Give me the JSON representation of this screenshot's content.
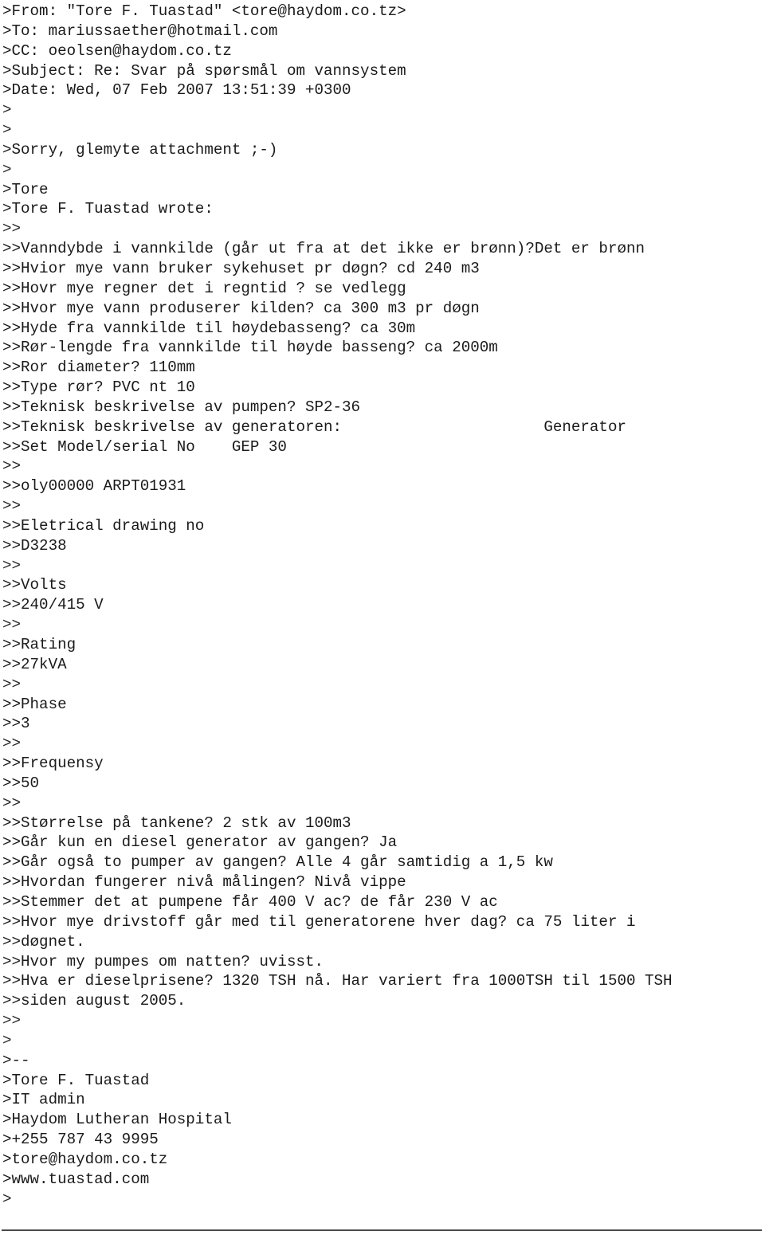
{
  "document": {
    "type": "quoted-email-thread",
    "headers": {
      "from_label": "From:",
      "from_value": "\"Tore F. Tuastad\" <tore@haydom.co.tz>",
      "to_label": "To:",
      "to_value": "mariussaether@hotmail.com",
      "cc_label": "CC:",
      "cc_value": "oeolsen@haydom.co.tz",
      "subject_label": "Subject:",
      "subject_value": "Re: Svar på spørsmål om vannsystem",
      "date_label": "Date:",
      "date_value": "Wed, 07 Feb 2007 13:51:39 +0300"
    },
    "signature": {
      "name": "Tore F. Tuastad",
      "role": "IT admin",
      "organization": "Haydom Lutheran Hospital",
      "phone": "+255 787 43 9995",
      "email": "tore@haydom.co.tz",
      "website": "www.tuastad.com"
    },
    "lines": [
      ">From: \"Tore F. Tuastad\" <tore@haydom.co.tz>",
      ">To: mariussaether@hotmail.com",
      ">CC: oeolsen@haydom.co.tz",
      ">Subject: Re: Svar på spørsmål om vannsystem",
      ">Date: Wed, 07 Feb 2007 13:51:39 +0300",
      ">",
      ">",
      ">Sorry, glemyte attachment ;-)",
      ">",
      ">Tore",
      ">Tore F. Tuastad wrote:",
      ">>",
      ">>Vanndybde i vannkilde (går ut fra at det ikke er brønn)?Det er brønn",
      ">>Hvior mye vann bruker sykehuset pr døgn? cd 240 m3",
      ">>Hovr mye regner det i regntid ? se vedlegg",
      ">>Hvor mye vann produserer kilden? ca 300 m3 pr døgn",
      ">>Hyde fra vannkilde til høydebasseng? ca 30m",
      ">>Rør-lengde fra vannkilde til høyde basseng? ca 2000m",
      ">>Ror diameter? 110mm",
      ">>Type rør? PVC nt 10",
      ">>Teknisk beskrivelse av pumpen? SP2-36",
      ">>Teknisk beskrivelse av generatoren:                      Generator",
      ">>Set Model/serial No    GEP 30",
      ">>",
      ">>oly00000 ARPT01931",
      ">>",
      ">>Eletrical drawing no",
      ">>D3238",
      ">>",
      ">>Volts",
      ">>240/415 V",
      ">>",
      ">>Rating",
      ">>27kVA",
      ">>",
      ">>Phase",
      ">>3",
      ">>",
      ">>Frequensy",
      ">>50",
      ">>",
      ">>Størrelse på tankene? 2 stk av 100m3",
      ">>Går kun en diesel generator av gangen? Ja",
      ">>Går også to pumper av gangen? Alle 4 går samtidig a 1,5 kw",
      ">>Hvordan fungerer nivå målingen? Nivå vippe",
      ">>Stemmer det at pumpene får 400 V ac? de får 230 V ac",
      ">>Hvor mye drivstoff går med til generatorene hver dag? ca 75 liter i",
      ">>døgnet.",
      ">>Hvor my pumpes om natten? uvisst.",
      ">>Hva er dieselprisene? 1320 TSH nå. Har variert fra 1000TSH til 1500 TSH",
      ">>siden august 2005.",
      ">>",
      ">",
      ">--",
      ">Tore F. Tuastad",
      ">IT admin",
      ">Haydom Lutheran Hospital",
      ">+255 787 43 9995",
      ">tore@haydom.co.tz",
      ">www.tuastad.com",
      ">"
    ]
  },
  "colors": {
    "page_background": "#ffffff",
    "text": "#1a1a1a",
    "rule": "#4a4a4a"
  }
}
